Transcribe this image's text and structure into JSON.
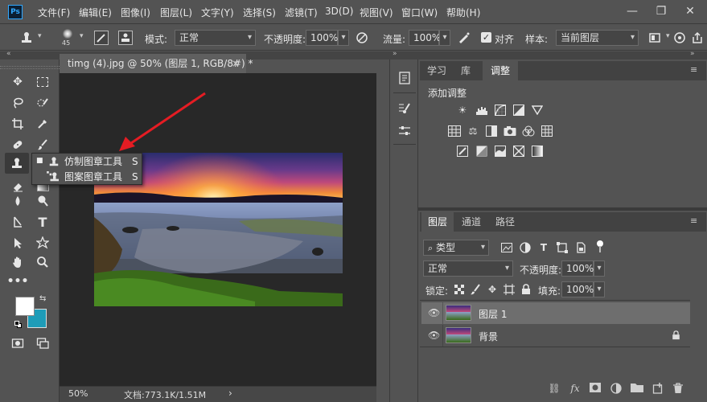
{
  "app": {
    "logo": "Ps",
    "accent": "#31a8ff"
  },
  "menubar": {
    "items": [
      "文件(F)",
      "编辑(E)",
      "图像(I)",
      "图层(L)",
      "文字(Y)",
      "选择(S)",
      "滤镜(T)",
      "3D(D)",
      "视图(V)",
      "窗口(W)",
      "帮助(H)"
    ]
  },
  "window": {
    "minimize": "—",
    "restore": "❐",
    "close": "✕"
  },
  "options": {
    "brush_size": "45",
    "mode_label": "模式:",
    "mode_value": "正常",
    "opacity_label": "不透明度:",
    "opacity_value": "100%",
    "flow_label": "流量:",
    "flow_value": "100%",
    "aligned_label": "对齐",
    "aligned_checked": true,
    "sample_label": "样本:",
    "sample_value": "当前图层"
  },
  "document": {
    "tab_title": "timg (4).jpg @ 50% (图层 1, RGB/8#) *",
    "close": "×",
    "zoom": "50%",
    "doc_info": "文档:773.1K/1.51M",
    "next": "›"
  },
  "flyout": {
    "items": [
      {
        "label": "仿制图章工具",
        "shortcut": "S",
        "active": true
      },
      {
        "label": "图案图章工具",
        "shortcut": "S",
        "active": false
      }
    ]
  },
  "panels": {
    "top_tabs": [
      "学习",
      "库",
      "调整"
    ],
    "active_top_tab": "调整",
    "adjust_title": "添加调整",
    "layer_tabs": [
      "图层",
      "通道",
      "路径"
    ],
    "active_layer_tab": "图层",
    "filter_kind": "类型",
    "blend_mode": "正常",
    "opacity_label": "不透明度:",
    "opacity_value": "100%",
    "lock_label": "锁定:",
    "fill_label": "填充:",
    "fill_value": "100%",
    "layers": [
      {
        "name": "图层 1",
        "selected": true,
        "locked": false
      },
      {
        "name": "背景",
        "selected": false,
        "locked": true
      }
    ]
  }
}
